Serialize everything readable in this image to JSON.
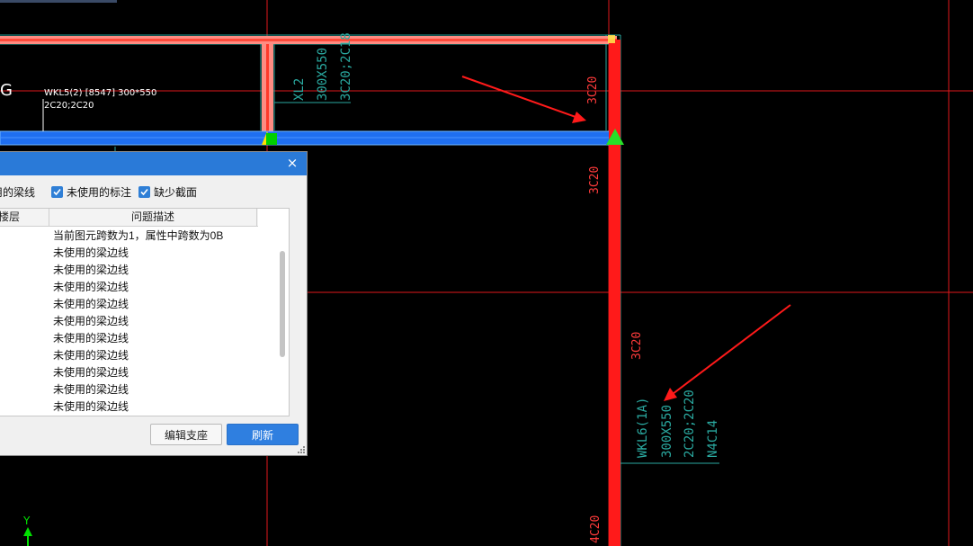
{
  "drawing": {
    "left_letter": "G",
    "beam_top_label_line1": "WKL5(2) [8547] 300*550",
    "beam_top_label_line2": "2C20;2C20",
    "xl2": {
      "name": "XL2",
      "size": "300X550",
      "rebar": "3C20;2C18"
    },
    "wkl6": {
      "name": "WKL6(1A)",
      "size": "300X550",
      "rebar": "2C20;2C20",
      "waist": "N4C14"
    },
    "rebar_marks": [
      "3C20",
      "3C20",
      "3C20",
      "4C20"
    ],
    "axis_y_label": "Y",
    "colors": {
      "grid_line": "#e0181c",
      "beam_blue": "#1f6ff0",
      "beam_red": "#ff1a1a",
      "annotation_teal": "#2aa9a0",
      "arrow": "#ff1a1a"
    }
  },
  "dialog": {
    "close_icon": "×",
    "filters": [
      {
        "label": "用的梁线",
        "checked": true
      },
      {
        "label": "未使用的标注",
        "checked": true
      },
      {
        "label": "缺少截面",
        "checked": true
      }
    ],
    "columns": [
      "楼层",
      "问题描述"
    ],
    "rows": [
      "当前图元跨数为1，属性中跨数为0B",
      "未使用的梁边线",
      "未使用的梁边线",
      "未使用的梁边线",
      "未使用的梁边线",
      "未使用的梁边线",
      "未使用的梁边线",
      "未使用的梁边线",
      "未使用的梁边线",
      "未使用的梁边线",
      "未使用的梁边线"
    ],
    "buttons": {
      "edit_support": "编辑支座",
      "refresh": "刷新"
    }
  }
}
